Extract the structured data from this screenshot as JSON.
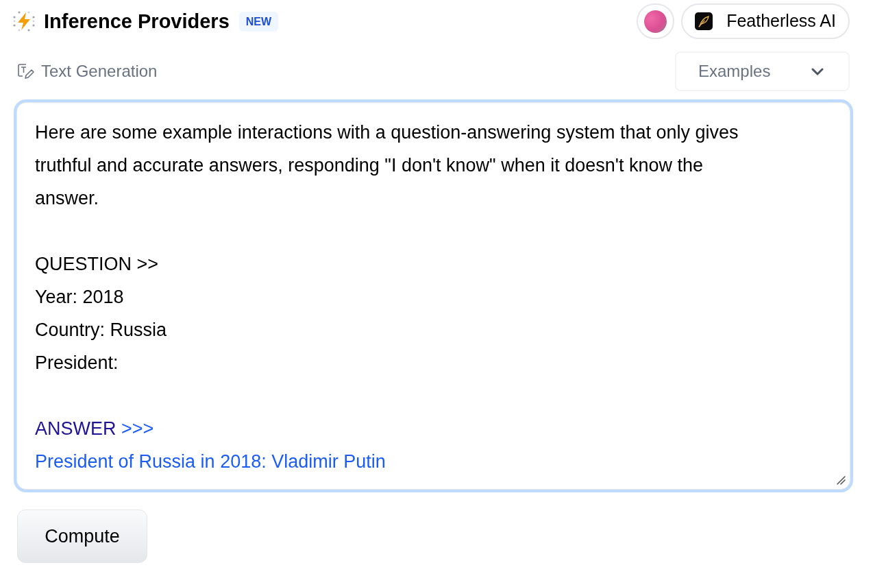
{
  "header": {
    "title": "Inference Providers",
    "badge": "NEW",
    "provider": {
      "label": "Featherless AI"
    }
  },
  "task": {
    "label": "Text Generation"
  },
  "examples": {
    "label": "Examples"
  },
  "editor": {
    "paragraphs": [
      {
        "lines": [
          {
            "segments": [
              {
                "kind": "prompt",
                "text": "Here are some example interactions with a question-answering system that only gives truthful and accurate answers, responding \"I don't know\" when it doesn't know the answer."
              }
            ]
          }
        ]
      },
      {
        "lines": [
          {
            "segments": [
              {
                "kind": "prompt",
                "text": "QUESTION >>"
              }
            ]
          },
          {
            "segments": [
              {
                "kind": "prompt",
                "text": "Year: 2018"
              }
            ]
          },
          {
            "segments": [
              {
                "kind": "prompt",
                "text": "Country: Russia"
              }
            ]
          },
          {
            "segments": [
              {
                "kind": "prompt",
                "text": "President:"
              }
            ]
          }
        ]
      },
      {
        "lines": [
          {
            "segments": [
              {
                "kind": "highlight",
                "text": "ANSWER"
              },
              {
                "kind": "generated",
                "text": ">>>"
              }
            ]
          },
          {
            "segments": [
              {
                "kind": "generated",
                "text": "President of Russia in 2018: Vladimir Putin"
              }
            ]
          }
        ]
      }
    ]
  },
  "compute_button": {
    "label": "Compute"
  }
}
